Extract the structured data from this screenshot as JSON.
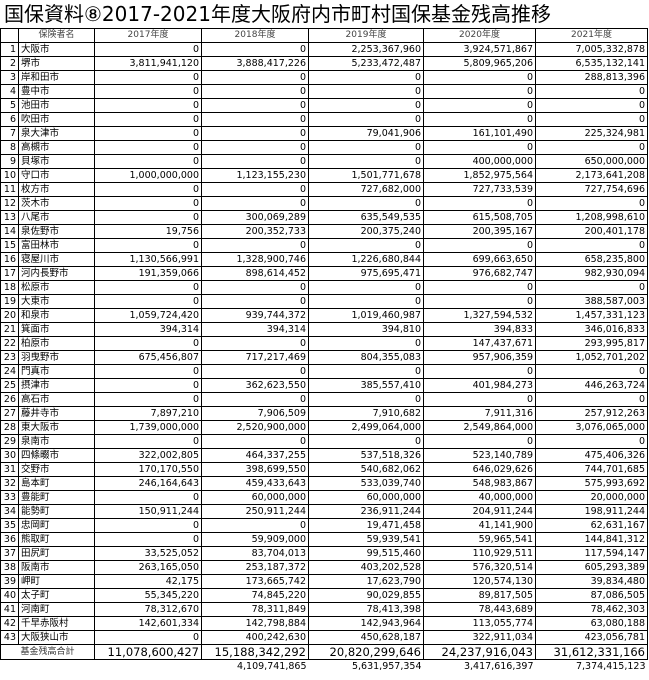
{
  "title": "国保資料⑧2017-2021年度大阪府内市町村国保基金残高推移",
  "headers": [
    "",
    "保険者名",
    "2017年度",
    "2018年度",
    "2019年度",
    "2020年度",
    "2021年度"
  ],
  "rows": [
    [
      "1",
      "大阪市",
      "0",
      "0",
      "2,253,367,960",
      "3,924,571,867",
      "7,005,332,878"
    ],
    [
      "2",
      "堺市",
      "3,811,941,120",
      "3,888,417,226",
      "5,233,472,487",
      "5,809,965,206",
      "6,535,132,141"
    ],
    [
      "3",
      "岸和田市",
      "0",
      "0",
      "0",
      "0",
      "288,813,396"
    ],
    [
      "4",
      "豊中市",
      "0",
      "0",
      "0",
      "0",
      "0"
    ],
    [
      "5",
      "池田市",
      "0",
      "0",
      "0",
      "0",
      "0"
    ],
    [
      "6",
      "吹田市",
      "0",
      "0",
      "0",
      "0",
      "0"
    ],
    [
      "7",
      "泉大津市",
      "0",
      "0",
      "79,041,906",
      "161,101,490",
      "225,324,981"
    ],
    [
      "8",
      "高槻市",
      "0",
      "0",
      "0",
      "0",
      "0"
    ],
    [
      "9",
      "貝塚市",
      "0",
      "0",
      "0",
      "400,000,000",
      "650,000,000"
    ],
    [
      "10",
      "守口市",
      "1,000,000,000",
      "1,123,155,230",
      "1,501,771,678",
      "1,852,975,564",
      "2,173,641,208"
    ],
    [
      "11",
      "枚方市",
      "0",
      "0",
      "727,682,000",
      "727,733,539",
      "727,754,696"
    ],
    [
      "12",
      "茨木市",
      "0",
      "0",
      "0",
      "0",
      "0"
    ],
    [
      "13",
      "八尾市",
      "0",
      "300,069,289",
      "635,549,535",
      "615,508,705",
      "1,208,998,610"
    ],
    [
      "14",
      "泉佐野市",
      "19,756",
      "200,352,733",
      "200,375,240",
      "200,395,167",
      "200,401,178"
    ],
    [
      "15",
      "富田林市",
      "0",
      "0",
      "0",
      "0",
      "0"
    ],
    [
      "16",
      "寝屋川市",
      "1,130,566,991",
      "1,328,900,746",
      "1,226,680,844",
      "699,663,650",
      "658,235,800"
    ],
    [
      "17",
      "河内長野市",
      "191,359,066",
      "898,614,452",
      "975,695,471",
      "976,682,747",
      "982,930,094"
    ],
    [
      "18",
      "松原市",
      "0",
      "0",
      "0",
      "0",
      "0"
    ],
    [
      "19",
      "大東市",
      "0",
      "0",
      "0",
      "0",
      "388,587,003"
    ],
    [
      "20",
      "和泉市",
      "1,059,724,420",
      "939,744,372",
      "1,019,460,987",
      "1,327,594,532",
      "1,457,331,123"
    ],
    [
      "21",
      "箕面市",
      "394,314",
      "394,314",
      "394,810",
      "394,833",
      "346,016,833"
    ],
    [
      "22",
      "柏原市",
      "0",
      "0",
      "0",
      "147,437,671",
      "293,995,817"
    ],
    [
      "23",
      "羽曳野市",
      "675,456,807",
      "717,217,469",
      "804,355,083",
      "957,906,359",
      "1,052,701,202"
    ],
    [
      "24",
      "門真市",
      "0",
      "0",
      "0",
      "0",
      "0"
    ],
    [
      "25",
      "摂津市",
      "0",
      "362,623,550",
      "385,557,410",
      "401,984,273",
      "446,263,724"
    ],
    [
      "26",
      "高石市",
      "0",
      "0",
      "0",
      "0",
      "0"
    ],
    [
      "27",
      "藤井寺市",
      "7,897,210",
      "7,906,509",
      "7,910,682",
      "7,911,316",
      "257,912,263"
    ],
    [
      "28",
      "東大阪市",
      "1,739,000,000",
      "2,520,900,000",
      "2,499,064,000",
      "2,549,864,000",
      "3,076,065,000"
    ],
    [
      "29",
      "泉南市",
      "0",
      "0",
      "0",
      "0",
      "0"
    ],
    [
      "30",
      "四條畷市",
      "322,002,805",
      "464,337,255",
      "537,518,326",
      "523,140,789",
      "475,406,326"
    ],
    [
      "31",
      "交野市",
      "170,170,550",
      "398,699,550",
      "540,682,062",
      "646,029,626",
      "744,701,685"
    ],
    [
      "32",
      "島本町",
      "246,164,643",
      "459,433,643",
      "533,039,740",
      "548,983,867",
      "575,993,692"
    ],
    [
      "33",
      "豊能町",
      "0",
      "60,000,000",
      "60,000,000",
      "40,000,000",
      "20,000,000"
    ],
    [
      "34",
      "能勢町",
      "150,911,244",
      "250,911,244",
      "236,911,244",
      "204,911,244",
      "198,911,244"
    ],
    [
      "35",
      "忠岡町",
      "0",
      "0",
      "19,471,458",
      "41,141,900",
      "62,631,167"
    ],
    [
      "36",
      "熊取町",
      "0",
      "59,909,000",
      "59,939,541",
      "59,965,541",
      "144,841,312"
    ],
    [
      "37",
      "田尻町",
      "33,525,052",
      "83,704,013",
      "99,515,460",
      "110,929,511",
      "117,594,147"
    ],
    [
      "38",
      "阪南市",
      "263,165,050",
      "253,187,372",
      "403,202,528",
      "576,320,514",
      "605,293,389"
    ],
    [
      "39",
      "岬町",
      "42,175",
      "173,665,742",
      "17,623,790",
      "120,574,130",
      "39,834,480"
    ],
    [
      "40",
      "太子町",
      "55,345,220",
      "74,845,220",
      "90,029,855",
      "89,817,505",
      "87,086,505"
    ],
    [
      "41",
      "河南町",
      "78,312,670",
      "78,311,849",
      "78,413,398",
      "78,443,689",
      "78,462,303"
    ],
    [
      "42",
      "千早赤阪村",
      "142,601,334",
      "142,798,884",
      "142,943,964",
      "113,055,774",
      "63,080,188"
    ],
    [
      "43",
      "大阪狭山市",
      "0",
      "400,242,630",
      "450,628,187",
      "322,911,034",
      "423,056,781"
    ]
  ],
  "total": {
    "label": "基金残高合計",
    "values": [
      "11,078,600,427",
      "15,188,342,292",
      "20,820,299,646",
      "24,237,916,043",
      "31,612,331,166"
    ]
  },
  "diff": [
    "4,109,741,865",
    "5,631,957,354",
    "3,417,616,397",
    "7,374,415,123"
  ]
}
